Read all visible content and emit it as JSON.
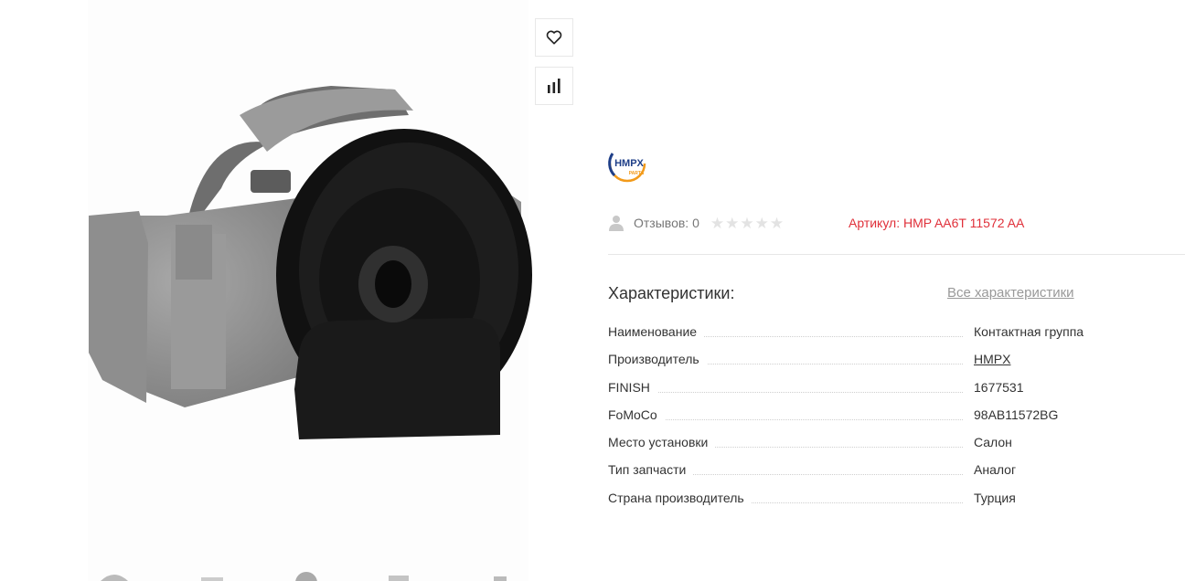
{
  "product": {
    "brand_logo": {
      "text": "HMPX",
      "sub": "PARTS",
      "color": "#1f3f88",
      "accent": "#f29a1a"
    },
    "reviews_label": "Отзывов: 0",
    "rating": 0,
    "rating_max": 5,
    "article": "Артикул: HMP AA6T 11572 AA",
    "article_color": "#e0303a"
  },
  "actions": {
    "favorite_icon": "heart-icon",
    "compare_icon": "bar-chart-icon"
  },
  "specs": {
    "title": "Характеристики:",
    "all_link": "Все характеристики",
    "rows": [
      {
        "label": "Наименование",
        "value": "Контактная группа",
        "link": false
      },
      {
        "label": "Производитель",
        "value": "HMPX",
        "link": true
      },
      {
        "label": "FINISH",
        "value": "1677531",
        "link": false
      },
      {
        "label": "FoMoCo",
        "value": "98AB11572BG",
        "link": false
      },
      {
        "label": "Место установки",
        "value": "Салон",
        "link": false
      },
      {
        "label": "Тип запчасти",
        "value": "Аналог",
        "link": false
      },
      {
        "label": "Страна производитель",
        "value": "Турция",
        "link": false
      }
    ]
  }
}
